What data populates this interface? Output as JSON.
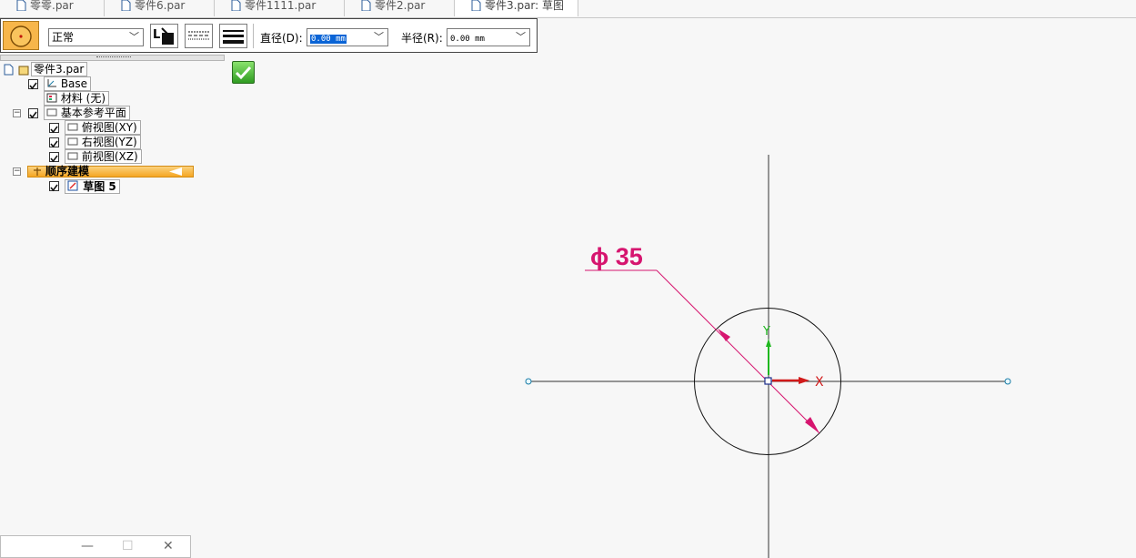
{
  "tabs": [
    {
      "label": "零零.par",
      "icon": "part-doc-icon"
    },
    {
      "label": "零件6.par",
      "icon": "part-doc-icon"
    },
    {
      "label": "零件1111.par",
      "icon": "part-doc-icon"
    },
    {
      "label": "零件2.par",
      "icon": "part-doc-icon"
    },
    {
      "label": "零件3.par: 草图",
      "icon": "part-doc-icon"
    }
  ],
  "command_bar": {
    "style_select": "正常",
    "diameter_label": "直径(D):",
    "diameter_value": "0.00 mm",
    "radius_label": "半径(R):",
    "radius_value": "0.00 mm"
  },
  "colors": {
    "accent_orange": "#f5a623",
    "dimension": "#d6156f",
    "axis_x": "#d11a1a",
    "axis_y": "#1fb81f",
    "selection_blue": "#0a64d6",
    "accept_green": "#2f9b21"
  },
  "pathfinder": {
    "root": "零件3.par",
    "base": "Base",
    "material": "材料 (无)",
    "ref_planes": "基本参考平面",
    "planes": [
      "俯视图(XY)",
      "右视图(YZ)",
      "前视图(XZ)"
    ],
    "sync_group": "顺序建模",
    "sketch": "草图 5"
  },
  "canvas": {
    "dimension_label": "ϕ 35",
    "axis_x_label": "X",
    "axis_y_label": "Y"
  },
  "mini_window": {
    "minimize": "—",
    "maximize": "☐",
    "close": "✕"
  }
}
